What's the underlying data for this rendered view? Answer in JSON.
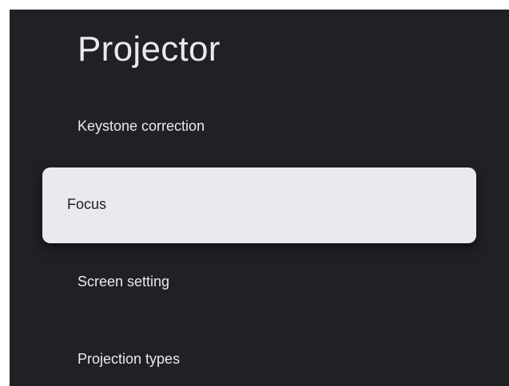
{
  "page": {
    "title": "Projector"
  },
  "menu": {
    "items": [
      {
        "label": "Keystone correction",
        "focused": false
      },
      {
        "label": "Focus",
        "focused": true
      },
      {
        "label": "Screen setting",
        "focused": false
      },
      {
        "label": "Projection types",
        "focused": false
      }
    ]
  },
  "colors": {
    "background": "#202124",
    "text": "#e8eaed",
    "focus_background": "#e8eaed",
    "focus_text": "#202124"
  }
}
